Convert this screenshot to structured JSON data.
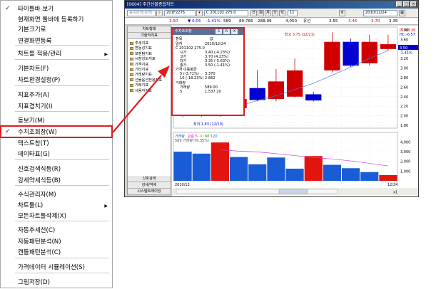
{
  "menu": {
    "items": [
      {
        "label": "타이틀바 보기",
        "checked": true
      },
      {
        "label": "현재화면 툴바에 등록하기"
      },
      {
        "label": "기본크기로"
      },
      {
        "label": "연결화면등록"
      },
      {
        "label": "차트를 적용/관리",
        "submenu": true
      },
      {
        "label": "기본차트(F)"
      },
      {
        "label": "차트환경설정(P)"
      },
      {
        "label": "지표추가(A)"
      },
      {
        "label": "지표겹치기(I)"
      },
      {
        "label": "돋보기(M)"
      },
      {
        "label": "수치조회창(W)",
        "checked": true,
        "highlighted": true
      },
      {
        "label": "텍스트창(T)"
      },
      {
        "label": "데이타표(G)"
      },
      {
        "label": "신호검색식등(R)"
      },
      {
        "label": "강세약세식등(B)"
      },
      {
        "label": "수식관리자(M)"
      },
      {
        "label": "차트툴(L)",
        "submenu": true
      },
      {
        "label": "모든차트툴삭제(X)"
      },
      {
        "label": "자동추세선(C)"
      },
      {
        "label": "자동패턴분석(N)"
      },
      {
        "label": "캔들패턴분석(C)"
      },
      {
        "label": "가격데이터 시뮬레이션(S)"
      },
      {
        "label": "그림저장(D)"
      }
    ]
  },
  "window": {
    "title": "[0604] 주간선물종합차트",
    "toolbar": {
      "search_placeholder": "종목검색(검색)",
      "code": "201F2275",
      "quote": "C 201102 275.0",
      "time_box": "11",
      "date": "2010/12/24"
    },
    "price_bar": {
      "values": [
        "3.50",
        "▼ 0.05",
        "-1.41%",
        "589",
        "89.766",
        "288.99",
        "4,050",
        "유선",
        "3.55",
        "3.45",
        "3.70",
        "3.35"
      ],
      "colors": [
        "#d00000",
        "#0000d0",
        "#0000d0",
        "#000000",
        "#000000",
        "#000000",
        "#000000",
        "#000000",
        "#000000",
        "#d00000",
        "#d00000",
        "#000000"
      ]
    },
    "left_panel": {
      "top_buttons": [
        "차트형태",
        "기술적지표"
      ],
      "items": [
        "추세지표",
        "변동성지표",
        "모멘텀지표",
        "시장강도지표",
        "가격지표",
        "기타지표",
        "거래량지표",
        "선물옵션전용지표",
        "거래지표",
        "사용자지표"
      ],
      "bottom_buttons": [
        "신호검색",
        "강세/약세",
        "시스템트레이딩"
      ]
    },
    "popup": {
      "title": "수치조회창",
      "buttons": [
        "S",
        "R",
        "X"
      ],
      "header": [
        "항목",
        "값"
      ],
      "rows": [
        [
          "일자",
          "2010/12/24"
        ],
        [
          "C 201102 275.0",
          ""
        ],
        [
          "시가",
          "3.40 (-4.23%)"
        ],
        [
          "고가",
          "3.70 (4.23%)"
        ],
        [
          "저가",
          "3.35 (-5.63%)"
        ],
        [
          "종가",
          "3.50 (-1.41%)"
        ],
        [
          "가격 이동평균",
          ""
        ],
        [
          "5 (-3.71%)",
          "3.370"
        ],
        [
          "10 (-18.23%)",
          "2.862"
        ],
        [
          "거래량",
          ""
        ],
        [
          "거래량",
          "589.00"
        ],
        [
          "5",
          "1,537.20"
        ]
      ]
    },
    "chart": {
      "high_label": "최고 3.75 (12/21)",
      "low_label": "최저 1.83 (12/10)",
      "price_axis": [
        "3.80",
        "3.60",
        "3.40",
        "3.20",
        "3.00",
        "2.80",
        "2.60",
        "2.40",
        "2.20",
        "2.00",
        "1.80"
      ],
      "right_labels": [
        "LC:88.26",
        "HC:-6.57",
        "3.50",
        "-1.41%"
      ],
      "volume_legend": {
        "label": "거래량",
        "items": [
          "단순 5",
          "20",
          "60",
          "120"
        ],
        "colors": [
          "#d000d0",
          "#d0a000",
          "#00a000",
          "#0070d0"
        ]
      },
      "volume_value": "589 거래량(76.35%)",
      "volume_axis": [
        "4,000",
        "3,000",
        "2,000",
        "1,000"
      ],
      "date_left": "2010/12",
      "date_right": "12/24",
      "units": "x1"
    }
  },
  "chart_data": {
    "type": "candlestick",
    "title": "",
    "candles": [
      {
        "open": 2.1,
        "close": 2.1,
        "high": 2.22,
        "low": 1.97,
        "color": "#d00000"
      },
      {
        "open": 2.1,
        "close": 2.1,
        "high": 2.2,
        "low": 1.97,
        "color": "#d00000"
      },
      {
        "open": 2.05,
        "close": 2.18,
        "high": 2.22,
        "low": 1.98,
        "color": "#d00000"
      },
      {
        "open": 2.16,
        "close": 2.35,
        "high": 2.4,
        "low": 2.12,
        "color": "#d00000"
      },
      {
        "open": 2.58,
        "close": 2.33,
        "high": 2.96,
        "low": 2.3,
        "color": "#0000d0"
      },
      {
        "open": 2.35,
        "close": 2.72,
        "high": 2.98,
        "low": 2.3,
        "color": "#d00000"
      },
      {
        "open": 2.4,
        "close": 2.95,
        "high": 3.2,
        "low": 2.38,
        "color": "#d00000"
      },
      {
        "open": 2.45,
        "close": 2.32,
        "high": 2.5,
        "low": 2.3,
        "color": "#0000d0"
      },
      {
        "open": 2.95,
        "close": 3.55,
        "high": 3.75,
        "low": 2.9,
        "color": "#d00000"
      },
      {
        "open": 3.55,
        "close": 3.05,
        "high": 3.62,
        "low": 3.02,
        "color": "#0000d0"
      },
      {
        "open": 3.1,
        "close": 3.55,
        "high": 3.7,
        "low": 3.05,
        "color": "#d00000"
      },
      {
        "open": 3.4,
        "close": 3.5,
        "high": 3.7,
        "low": 3.35,
        "color": "#d00000"
      }
    ],
    "ma5": [
      2.1,
      2.12,
      2.15,
      2.2,
      2.32,
      2.42,
      2.55,
      2.68,
      2.85,
      3.02,
      3.2,
      3.37
    ],
    "ylim": [
      1.8,
      3.8
    ],
    "volume": {
      "values": [
        3000,
        2800,
        3950,
        2450,
        1700,
        2400,
        1250,
        2550,
        1650,
        1300,
        900,
        589
      ],
      "colors": [
        "#1a5cd6",
        "#1a5cd6",
        "#e2150e",
        "#1a5cd6",
        "#1a5cd6",
        "#1a5cd6",
        "#1a5cd6",
        "#e2150e",
        "#1a5cd6",
        "#1a5cd6",
        "#1a5cd6",
        "#e2150e"
      ],
      "ma5": [
        null,
        null,
        3200,
        3050,
        2980,
        2800,
        2600,
        2400,
        2250,
        2050,
        1800,
        1537
      ],
      "ylim": [
        0,
        4400
      ]
    }
  }
}
